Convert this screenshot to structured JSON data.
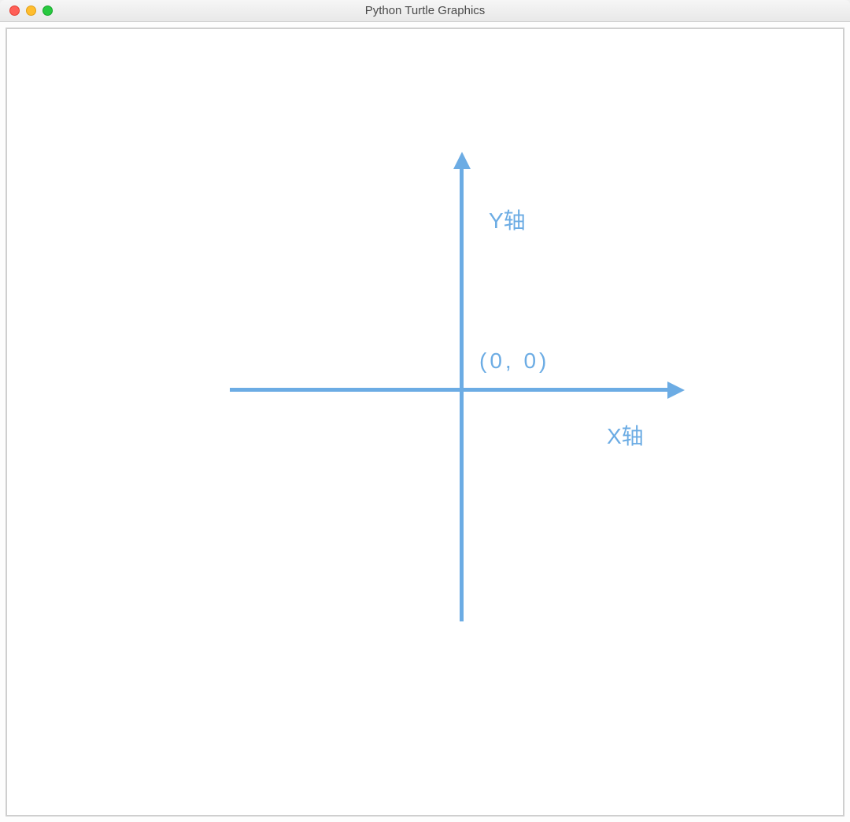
{
  "window": {
    "title": "Python Turtle Graphics"
  },
  "labels": {
    "y_axis": "Y轴",
    "x_axis": "X轴",
    "origin": "(0,  0)"
  },
  "colors": {
    "axis": "#6cace4"
  },
  "chart_data": {
    "type": "diagram",
    "description": "2D Cartesian coordinate system",
    "origin": {
      "x": 0,
      "y": 0
    },
    "axes": [
      {
        "name": "X轴",
        "direction": "right"
      },
      {
        "name": "Y轴",
        "direction": "up"
      }
    ]
  }
}
